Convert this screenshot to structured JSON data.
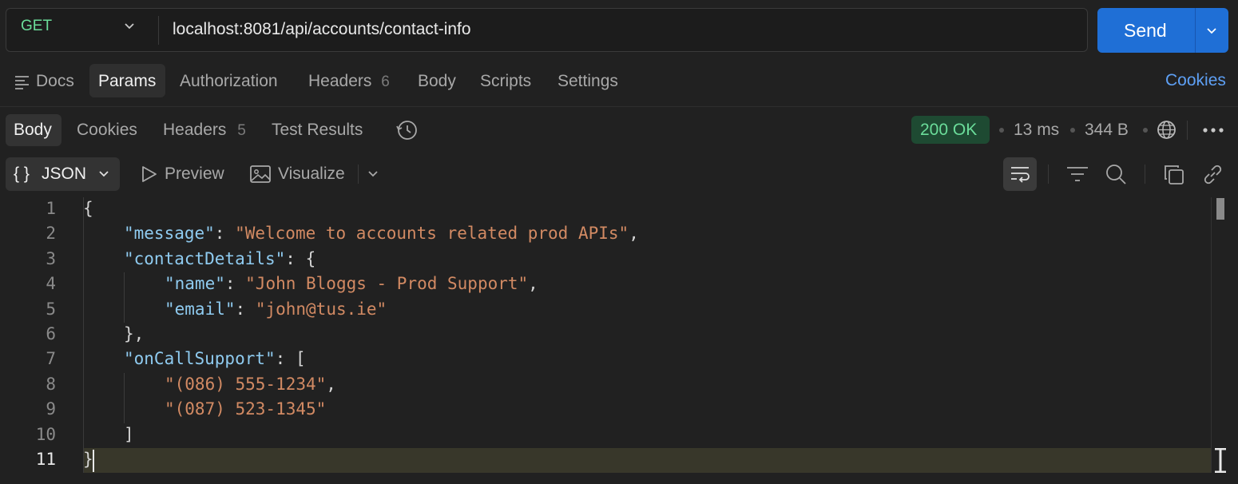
{
  "request": {
    "method": "GET",
    "url": "localhost:8081/api/accounts/contact-info",
    "send_label": "Send"
  },
  "request_tabs": {
    "docs": "Docs",
    "params": "Params",
    "authorization": "Authorization",
    "headers": "Headers",
    "headers_count": "6",
    "body": "Body",
    "scripts": "Scripts",
    "settings": "Settings",
    "cookies": "Cookies"
  },
  "response_tabs": {
    "body": "Body",
    "cookies": "Cookies",
    "headers": "Headers",
    "headers_count": "5",
    "test_results": "Test Results"
  },
  "response_meta": {
    "status": "200 OK",
    "time": "13 ms",
    "size": "344 B"
  },
  "toolbar": {
    "format": "JSON",
    "preview": "Preview",
    "visualize": "Visualize"
  },
  "code": {
    "line_numbers": [
      "1",
      "2",
      "3",
      "4",
      "5",
      "6",
      "7",
      "8",
      "9",
      "10",
      "11"
    ],
    "lines": [
      {
        "p0": "{"
      },
      {
        "k": "\"message\"",
        "p1": ": ",
        "s": "\"Welcome to accounts related prod APIs\"",
        "p2": ","
      },
      {
        "k": "\"contactDetails\"",
        "p1": ": {"
      },
      {
        "k": "\"name\"",
        "p1": ": ",
        "s": "\"John Bloggs - Prod Support\"",
        "p2": ","
      },
      {
        "k": "\"email\"",
        "p1": ": ",
        "s": "\"john@tus.ie\""
      },
      {
        "p0": "},"
      },
      {
        "k": "\"onCallSupport\"",
        "p1": ": ["
      },
      {
        "s": "\"(086) 555-1234\"",
        "p2": ","
      },
      {
        "s": "\"(087) 523-1345\""
      },
      {
        "p0": "]"
      },
      {
        "p0": "}"
      }
    ]
  },
  "colors": {
    "accent": "#1f6fd6",
    "status_ok": "#6bdd9a",
    "json_key": "#8fcbf0",
    "json_string": "#d28a63"
  }
}
